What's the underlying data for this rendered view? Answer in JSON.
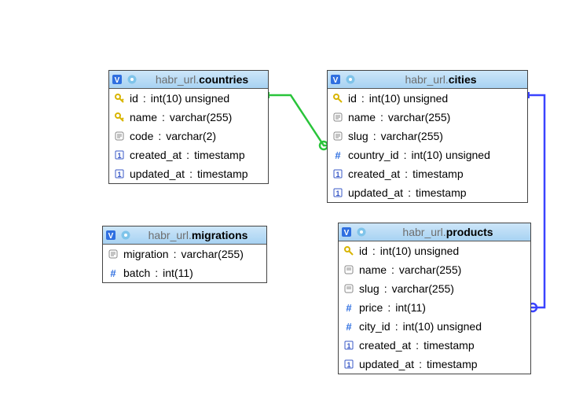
{
  "schema": "habr_url.",
  "tables": {
    "countries": {
      "name": "countries",
      "columns": [
        {
          "icon": "key",
          "name": "id",
          "type": "int(10) unsigned"
        },
        {
          "icon": "key",
          "name": "name",
          "type": "varchar(255)"
        },
        {
          "icon": "text",
          "name": "code",
          "type": "varchar(2)"
        },
        {
          "icon": "clock",
          "name": "created_at",
          "type": "timestamp"
        },
        {
          "icon": "clock",
          "name": "updated_at",
          "type": "timestamp"
        }
      ]
    },
    "cities": {
      "name": "cities",
      "columns": [
        {
          "icon": "key",
          "name": "id",
          "type": "int(10) unsigned"
        },
        {
          "icon": "text",
          "name": "name",
          "type": "varchar(255)"
        },
        {
          "icon": "text",
          "name": "slug",
          "type": "varchar(255)"
        },
        {
          "icon": "hash",
          "name": "country_id",
          "type": "int(10) unsigned"
        },
        {
          "icon": "clock",
          "name": "created_at",
          "type": "timestamp"
        },
        {
          "icon": "clock",
          "name": "updated_at",
          "type": "timestamp"
        }
      ]
    },
    "migrations": {
      "name": "migrations",
      "columns": [
        {
          "icon": "text",
          "name": "migration",
          "type": "varchar(255)"
        },
        {
          "icon": "hash",
          "name": "batch",
          "type": "int(11)"
        }
      ]
    },
    "products": {
      "name": "products",
      "columns": [
        {
          "icon": "key",
          "name": "id",
          "type": "int(10) unsigned"
        },
        {
          "icon": "text",
          "name": "name",
          "type": "varchar(255)"
        },
        {
          "icon": "text",
          "name": "slug",
          "type": "varchar(255)"
        },
        {
          "icon": "hash",
          "name": "price",
          "type": "int(11)"
        },
        {
          "icon": "hash",
          "name": "city_id",
          "type": "int(10) unsigned"
        },
        {
          "icon": "clock",
          "name": "created_at",
          "type": "timestamp"
        },
        {
          "icon": "clock",
          "name": "updated_at",
          "type": "timestamp"
        }
      ]
    }
  },
  "relations": [
    {
      "from": "cities.country_id",
      "to": "countries.id",
      "color": "green"
    },
    {
      "from": "products.city_id",
      "to": "cities.id",
      "color": "blue"
    }
  ]
}
